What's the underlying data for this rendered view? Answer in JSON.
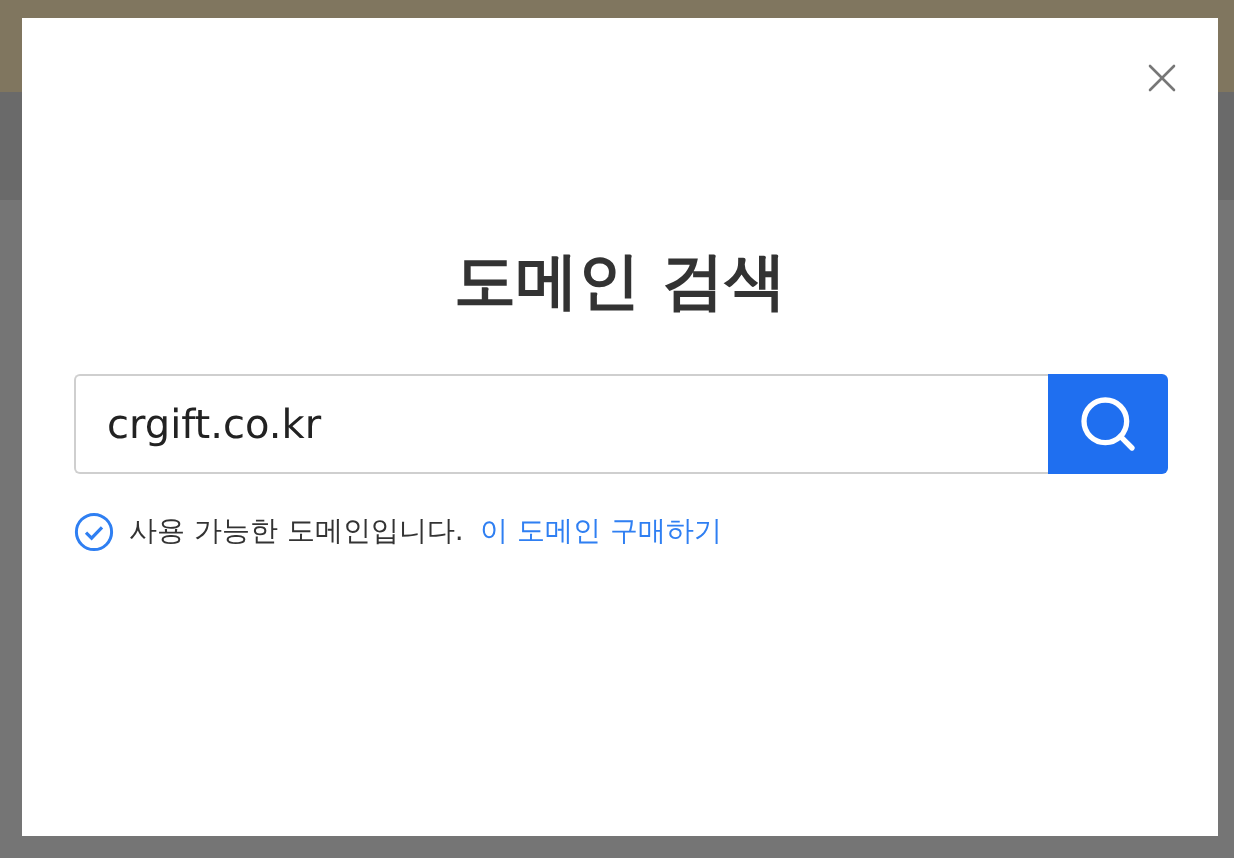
{
  "dialog": {
    "title": "도메인 검색",
    "search": {
      "value": "crgift.co.kr"
    },
    "result": {
      "available": true,
      "message": "사용 가능한 도메인입니다.",
      "link": "이 도메인 구매하기"
    }
  }
}
